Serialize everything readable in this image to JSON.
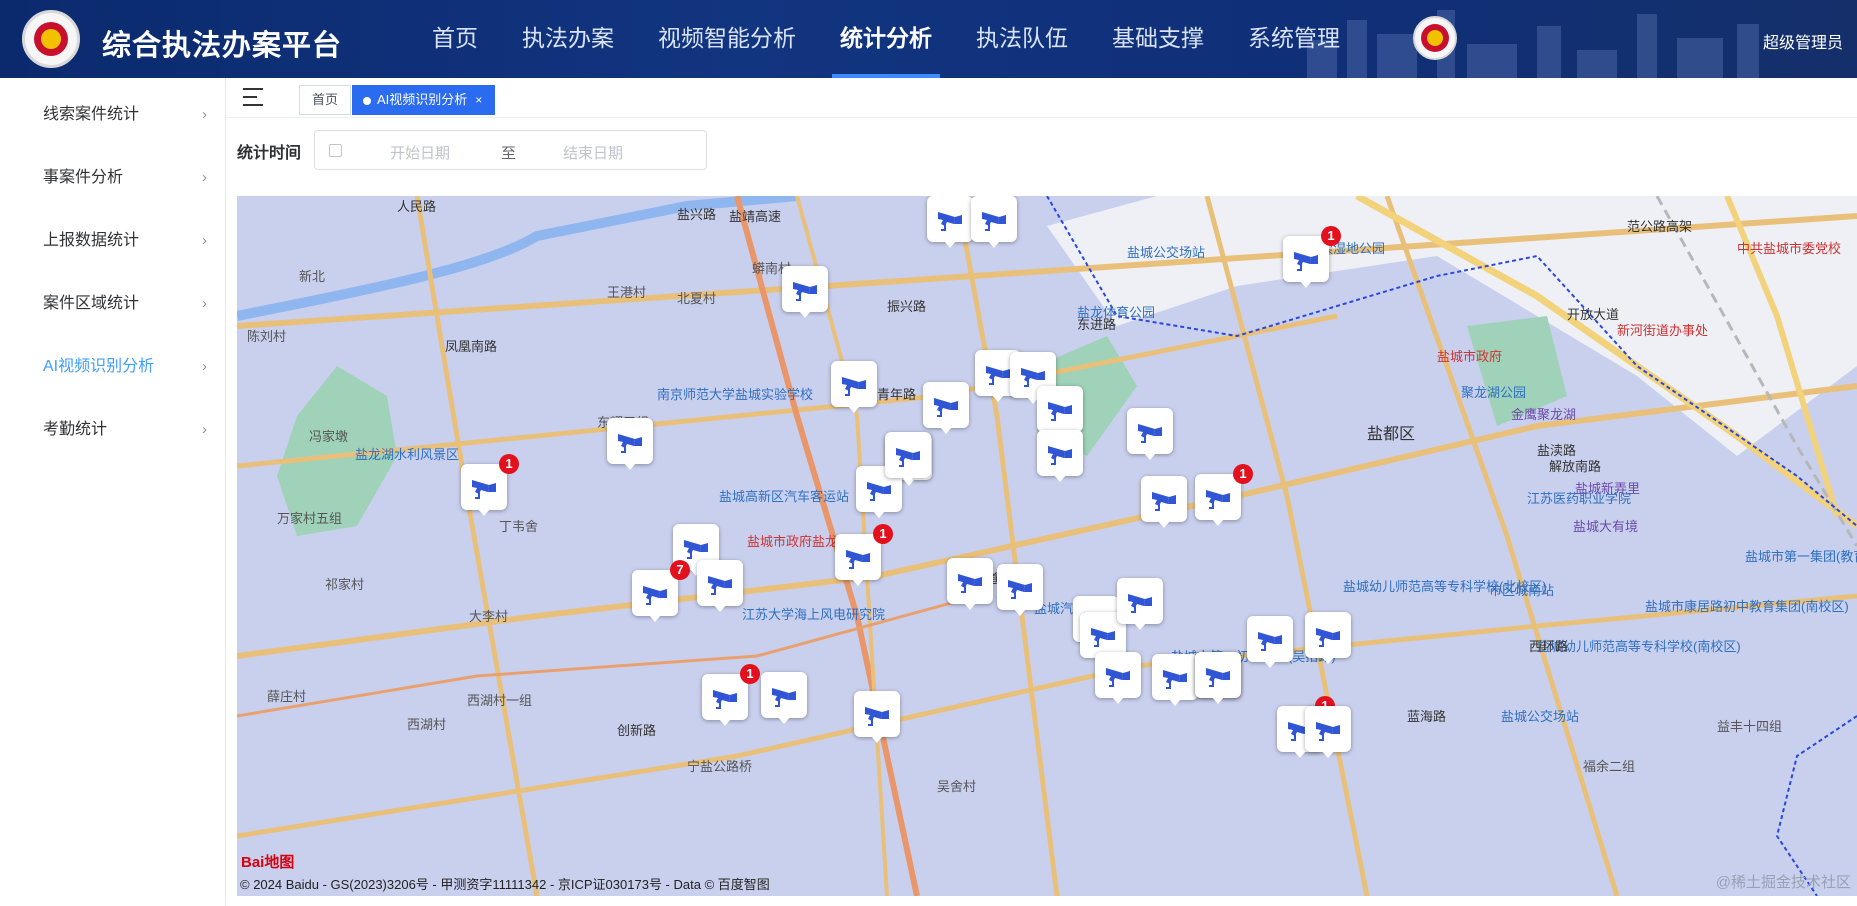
{
  "app": {
    "title": "综合执法办案平台",
    "user": "超级管理员"
  },
  "nav": [
    {
      "label": "首页"
    },
    {
      "label": "执法办案"
    },
    {
      "label": "视频智能分析"
    },
    {
      "label": "统计分析",
      "active": true
    },
    {
      "label": "执法队伍"
    },
    {
      "label": "基础支撑"
    },
    {
      "label": "系统管理"
    }
  ],
  "sidebar": {
    "items": [
      {
        "label": "线索案件统计"
      },
      {
        "label": "事案件分析"
      },
      {
        "label": "上报数据统计"
      },
      {
        "label": "案件区域统计"
      },
      {
        "label": "AI视频识别分析",
        "active": true
      },
      {
        "label": "考勤统计"
      }
    ],
    "chevron": "›"
  },
  "tabs": {
    "home": "首页",
    "current": "AI视频识别分析",
    "close": "×"
  },
  "filter": {
    "label": "统计时间",
    "start_placeholder": "开始日期",
    "separator": "至",
    "end_placeholder": "结束日期"
  },
  "map": {
    "copyright": "© 2024 Baidu - GS(2023)3206号 - 甲测资字11111342 - 京ICP证030173号 - Data © 百度智图",
    "logo": "Bai地图",
    "watermark": "@稀土掘金技术社区",
    "colors": {
      "map_bg": "#c9d0ee",
      "camera": "#3056d6",
      "badge": "#e3111d"
    },
    "labels": [
      {
        "text": "盐兴路",
        "cls": "road"
      },
      {
        "text": "盐靖高速",
        "cls": "road"
      },
      {
        "text": "王港村",
        "cls": ""
      },
      {
        "text": "北夏村",
        "cls": ""
      },
      {
        "text": "蟒南村",
        "cls": ""
      },
      {
        "text": "新北",
        "cls": ""
      },
      {
        "text": "凤凰南路",
        "cls": "road"
      },
      {
        "text": "陈刘村",
        "cls": ""
      },
      {
        "text": "南京师范大学盐城实验学校",
        "cls": "poi"
      },
      {
        "text": "东耀五组",
        "cls": ""
      },
      {
        "text": "盐龙湖水利风景区",
        "cls": "poi"
      },
      {
        "text": "冯家墩",
        "cls": ""
      },
      {
        "text": "万家村五组",
        "cls": ""
      },
      {
        "text": "丁韦舍",
        "cls": ""
      },
      {
        "text": "祁家村",
        "cls": ""
      },
      {
        "text": "大李村",
        "cls": ""
      },
      {
        "text": "盐城高新区汽车客运站",
        "cls": "poi"
      },
      {
        "text": "盐城市政府盐龙办事处",
        "cls": "red"
      },
      {
        "text": "江苏大学海上风电研究院",
        "cls": "poi"
      },
      {
        "text": "世纪大道",
        "cls": "road"
      },
      {
        "text": "盐城汽车客运西站",
        "cls": "poi"
      },
      {
        "text": "盐龙体育公园",
        "cls": "poi"
      },
      {
        "text": "盐城公交场站",
        "cls": "poi"
      },
      {
        "text": "盐渎湿地公园",
        "cls": "poi"
      },
      {
        "text": "东进路",
        "cls": "road"
      },
      {
        "text": "盐城市政府",
        "cls": "red"
      },
      {
        "text": "聚龙湖公园",
        "cls": "poi"
      },
      {
        "text": "金鹰聚龙湖",
        "cls": "purple"
      },
      {
        "text": "盐都区",
        "cls": "big"
      },
      {
        "text": "解放南路",
        "cls": "road"
      },
      {
        "text": "盐渎路",
        "cls": "road"
      },
      {
        "text": "江苏医药职业学院",
        "cls": "poi"
      },
      {
        "text": "盐城大有境",
        "cls": "purple"
      },
      {
        "text": "盐城幼儿师范高等专科学校(北校区)",
        "cls": "poi"
      },
      {
        "text": "市区城南站",
        "cls": "poi"
      },
      {
        "text": "盐城新弄里",
        "cls": "purple"
      },
      {
        "text": "开放大道",
        "cls": "road"
      },
      {
        "text": "范公路高架",
        "cls": "road"
      },
      {
        "text": "中共盐城市委党校",
        "cls": "red"
      },
      {
        "text": "新河街道办事处",
        "cls": "red"
      },
      {
        "text": "盐城市第一集团(教育)",
        "cls": "poi"
      },
      {
        "text": "盐城市康居路初中教育集团(南校区)",
        "cls": "poi"
      },
      {
        "text": "盐城幼儿师范高等专科学校(南校区)",
        "cls": "poi"
      },
      {
        "text": "盐城公交场站",
        "cls": "poi"
      },
      {
        "text": "益丰十四组",
        "cls": ""
      },
      {
        "text": "福余二组",
        "cls": ""
      },
      {
        "text": "蓝海路",
        "cls": "road"
      },
      {
        "text": "盐城市第一初级中学(吴抬路)",
        "cls": "poi"
      },
      {
        "text": "西环路",
        "cls": "road"
      },
      {
        "text": "薛庄村",
        "cls": ""
      },
      {
        "text": "西湖村一组",
        "cls": ""
      },
      {
        "text": "西湖村",
        "cls": ""
      },
      {
        "text": "创新路",
        "cls": "road"
      },
      {
        "text": "宁盐公路桥",
        "cls": ""
      },
      {
        "text": "吴舍村",
        "cls": ""
      },
      {
        "text": "振兴路",
        "cls": "road"
      },
      {
        "text": "青年路",
        "cls": "road"
      },
      {
        "text": "人民路",
        "cls": "road"
      }
    ],
    "markers": [
      {
        "badge": ""
      },
      {
        "badge": ""
      },
      {
        "badge": ""
      },
      {
        "badge": "1"
      },
      {
        "badge": ""
      },
      {
        "badge": ""
      },
      {
        "badge": "1"
      },
      {
        "badge": ""
      },
      {
        "badge": ""
      },
      {
        "badge": ""
      },
      {
        "badge": ""
      },
      {
        "badge": ""
      },
      {
        "badge": ""
      },
      {
        "badge": ""
      },
      {
        "badge": ""
      },
      {
        "badge": ""
      },
      {
        "badge": "1"
      },
      {
        "badge": ""
      },
      {
        "badge": ""
      },
      {
        "badge": "7"
      },
      {
        "badge": ""
      },
      {
        "badge": "1"
      },
      {
        "badge": ""
      },
      {
        "badge": ""
      },
      {
        "badge": ""
      },
      {
        "badge": ""
      },
      {
        "badge": ""
      },
      {
        "badge": ""
      },
      {
        "badge": ""
      },
      {
        "badge": ""
      },
      {
        "badge": "1"
      },
      {
        "badge": ""
      },
      {
        "badge": ""
      },
      {
        "badge": "1"
      },
      {
        "badge": ""
      },
      {
        "badge": ""
      },
      {
        "badge": ""
      },
      {
        "badge": ""
      }
    ]
  }
}
